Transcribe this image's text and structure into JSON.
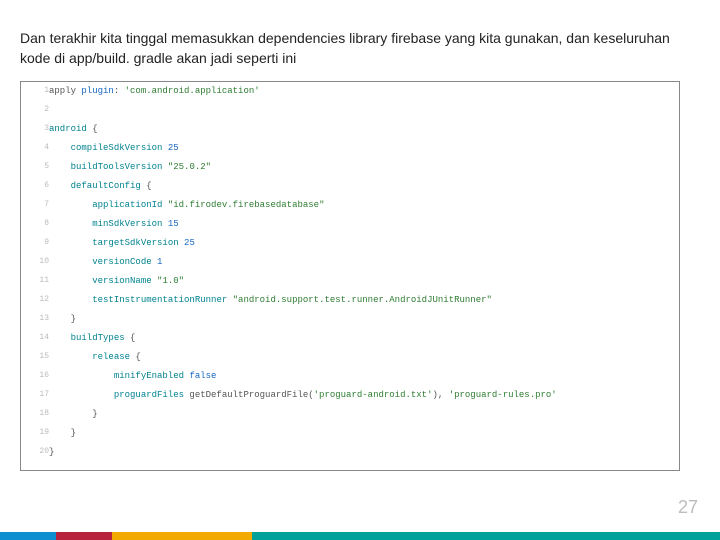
{
  "description": "Dan terakhir kita tinggal memasukkan dependencies library firebase yang kita gunakan, dan keseluruhan kode di app/build. gradle akan jadi seperti ini",
  "page_number": "27",
  "code": {
    "lines": [
      {
        "n": "1",
        "indent": 0,
        "segs": [
          [
            "pl",
            "apply "
          ],
          [
            "kw-blue",
            "plugin"
          ],
          [
            "pl",
            ": "
          ],
          [
            "str",
            "'com.android.application'"
          ]
        ]
      },
      {
        "n": "2",
        "indent": 0,
        "segs": []
      },
      {
        "n": "3",
        "indent": 0,
        "segs": [
          [
            "kw-teal",
            "android"
          ],
          [
            "pl",
            " {"
          ]
        ]
      },
      {
        "n": "4",
        "indent": 1,
        "segs": [
          [
            "kw-teal",
            "compileSdkVersion"
          ],
          [
            "pl",
            " "
          ],
          [
            "num",
            "25"
          ]
        ]
      },
      {
        "n": "5",
        "indent": 1,
        "segs": [
          [
            "kw-teal",
            "buildToolsVersion"
          ],
          [
            "pl",
            " "
          ],
          [
            "str",
            "\"25.0.2\""
          ]
        ]
      },
      {
        "n": "6",
        "indent": 1,
        "segs": [
          [
            "kw-teal",
            "defaultConfig"
          ],
          [
            "pl",
            " {"
          ]
        ]
      },
      {
        "n": "7",
        "indent": 2,
        "segs": [
          [
            "kw-teal",
            "applicationId"
          ],
          [
            "pl",
            " "
          ],
          [
            "str",
            "\"id.firodev.firebasedatabase\""
          ]
        ]
      },
      {
        "n": "8",
        "indent": 2,
        "segs": [
          [
            "kw-teal",
            "minSdkVersion"
          ],
          [
            "pl",
            " "
          ],
          [
            "num",
            "15"
          ]
        ]
      },
      {
        "n": "9",
        "indent": 2,
        "segs": [
          [
            "kw-teal",
            "targetSdkVersion"
          ],
          [
            "pl",
            " "
          ],
          [
            "num",
            "25"
          ]
        ]
      },
      {
        "n": "10",
        "indent": 2,
        "segs": [
          [
            "kw-teal",
            "versionCode"
          ],
          [
            "pl",
            " "
          ],
          [
            "num",
            "1"
          ]
        ]
      },
      {
        "n": "11",
        "indent": 2,
        "segs": [
          [
            "kw-teal",
            "versionName"
          ],
          [
            "pl",
            " "
          ],
          [
            "str",
            "\"1.0\""
          ]
        ]
      },
      {
        "n": "12",
        "indent": 2,
        "segs": [
          [
            "kw-teal",
            "testInstrumentationRunner"
          ],
          [
            "pl",
            " "
          ],
          [
            "str",
            "\"android.support.test.runner.AndroidJUnitRunner\""
          ]
        ]
      },
      {
        "n": "13",
        "indent": 1,
        "segs": [
          [
            "pl",
            "}"
          ]
        ]
      },
      {
        "n": "14",
        "indent": 1,
        "segs": [
          [
            "kw-teal",
            "buildTypes"
          ],
          [
            "pl",
            " {"
          ]
        ]
      },
      {
        "n": "15",
        "indent": 2,
        "segs": [
          [
            "kw-teal",
            "release"
          ],
          [
            "pl",
            " {"
          ]
        ]
      },
      {
        "n": "16",
        "indent": 3,
        "segs": [
          [
            "kw-teal",
            "minifyEnabled"
          ],
          [
            "pl",
            " "
          ],
          [
            "kw-blue",
            "false"
          ]
        ]
      },
      {
        "n": "17",
        "indent": 3,
        "segs": [
          [
            "kw-teal",
            "proguardFiles"
          ],
          [
            "pl",
            " getDefaultProguardFile("
          ],
          [
            "str",
            "'proguard-android.txt'"
          ],
          [
            "pl",
            "), "
          ],
          [
            "str",
            "'proguard-rules.pro'"
          ]
        ]
      },
      {
        "n": "18",
        "indent": 2,
        "segs": [
          [
            "pl",
            "}"
          ]
        ]
      },
      {
        "n": "19",
        "indent": 1,
        "segs": [
          [
            "pl",
            "}"
          ]
        ]
      },
      {
        "n": "20",
        "indent": 0,
        "segs": [
          [
            "pl",
            "}"
          ]
        ]
      }
    ]
  }
}
